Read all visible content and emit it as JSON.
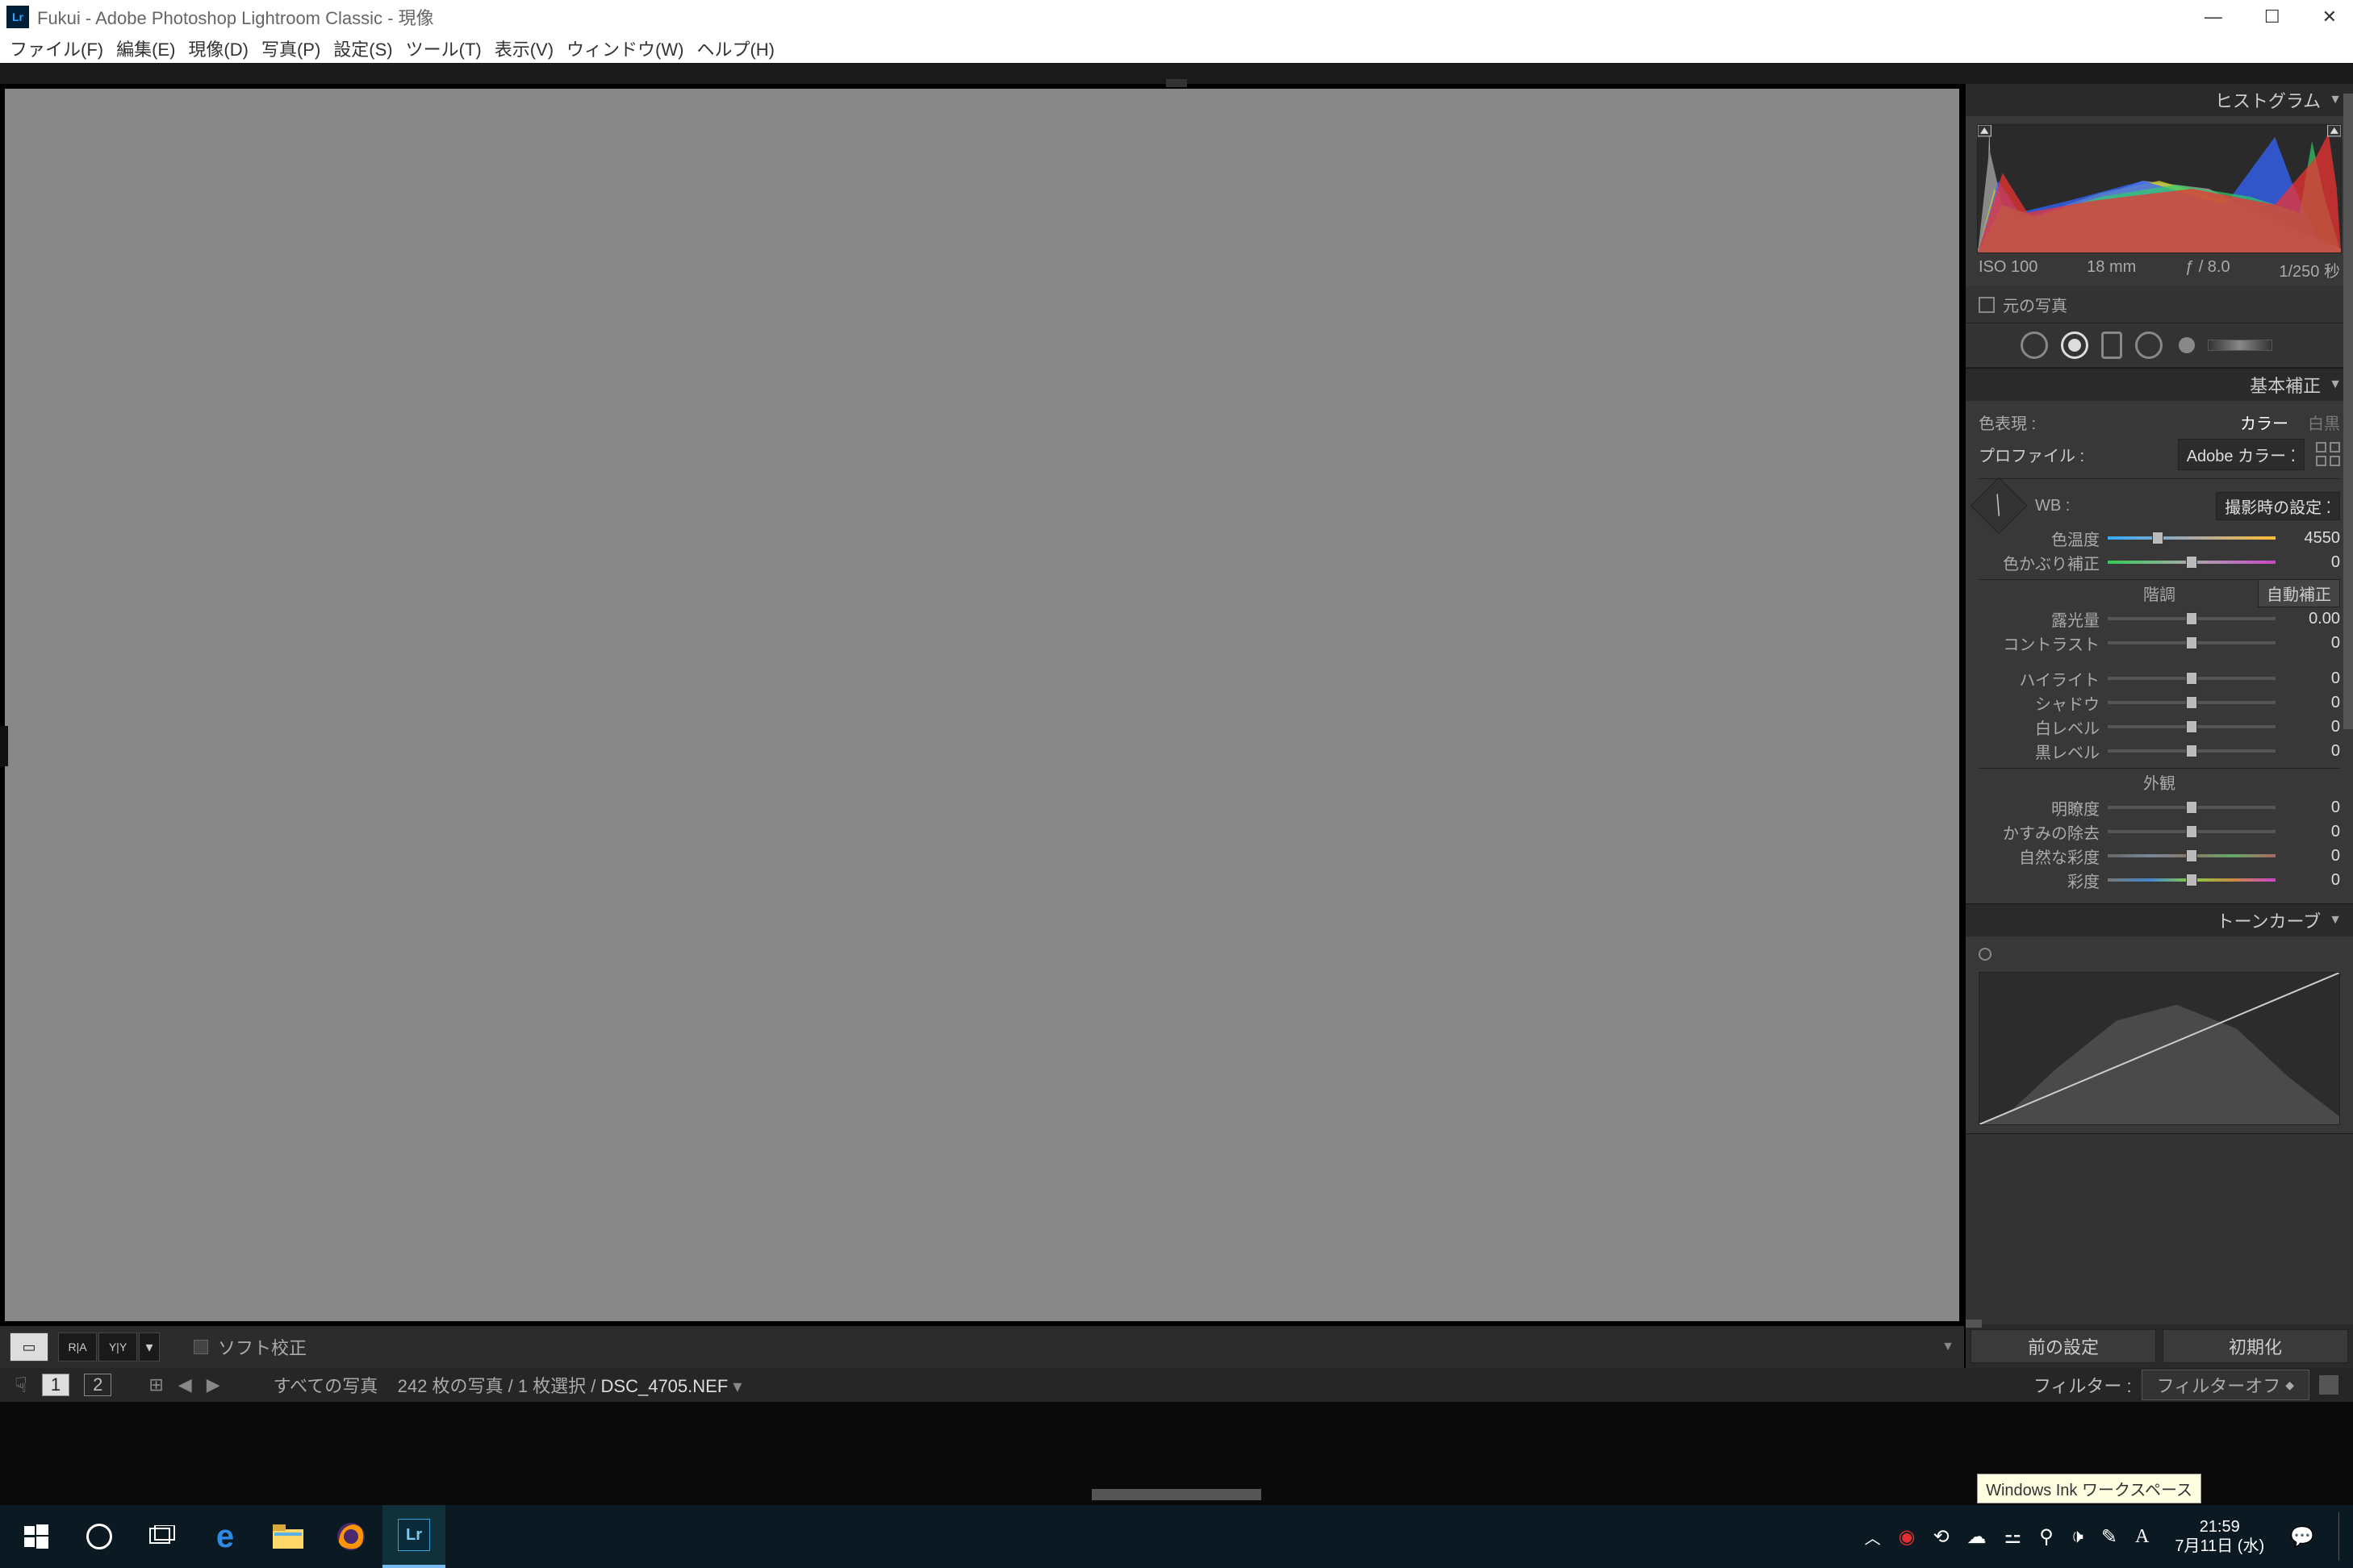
{
  "titlebar": {
    "title": "Fukui - Adobe Photoshop Lightroom Classic - 現像",
    "app_abbr": "Lr"
  },
  "menu": [
    "ファイル(F)",
    "編集(E)",
    "現像(D)",
    "写真(P)",
    "設定(S)",
    "ツール(T)",
    "表示(V)",
    "ウィンドウ(W)",
    "ヘルプ(H)"
  ],
  "canvas_toolbar": {
    "soft_proof": "ソフト校正"
  },
  "panels": {
    "histogram_title": "ヒストグラム",
    "meta": {
      "iso": "ISO 100",
      "focal": "18 mm",
      "aperture": "ƒ / 8.0",
      "shutter": "1/250 秒"
    },
    "original": "元の写真",
    "basic_title": "基本補正",
    "treatment": {
      "label": "色表現 :",
      "color": "カラー",
      "bw": "白黒"
    },
    "profile": {
      "label": "プロファイル :",
      "value": "Adobe カラー"
    },
    "wb": {
      "label": "WB :",
      "value": "撮影時の設定"
    },
    "sliders": {
      "temp": {
        "label": "色温度",
        "value": "4550"
      },
      "tint": {
        "label": "色かぶり補正",
        "value": "0"
      },
      "tone_head": "階調",
      "auto": "自動補正",
      "exposure": {
        "label": "露光量",
        "value": "0.00"
      },
      "contrast": {
        "label": "コントラスト",
        "value": "0"
      },
      "highlights": {
        "label": "ハイライト",
        "value": "0"
      },
      "shadows": {
        "label": "シャドウ",
        "value": "0"
      },
      "whites": {
        "label": "白レベル",
        "value": "0"
      },
      "blacks": {
        "label": "黒レベル",
        "value": "0"
      },
      "presence_head": "外観",
      "clarity": {
        "label": "明瞭度",
        "value": "0"
      },
      "dehaze": {
        "label": "かすみの除去",
        "value": "0"
      },
      "vibrance": {
        "label": "自然な彩度",
        "value": "0"
      },
      "saturation": {
        "label": "彩度",
        "value": "0"
      }
    },
    "tonecurve_title": "トーンカーブ",
    "prev_settings": "前の設定",
    "reset": "初期化"
  },
  "filmstrip": {
    "main_label": "1",
    "second_label": "2",
    "all_photos": "すべての写真",
    "count_text": "242 枚の写真 / 1 枚選択 /",
    "filename": "DSC_4705.NEF",
    "filter_label": "フィルター :",
    "filter_value": "フィルターオフ"
  },
  "taskbar": {
    "clock_time": "21:59",
    "clock_date": "7月11日 (水)",
    "ink_tooltip": "Windows Ink ワークスペース"
  }
}
